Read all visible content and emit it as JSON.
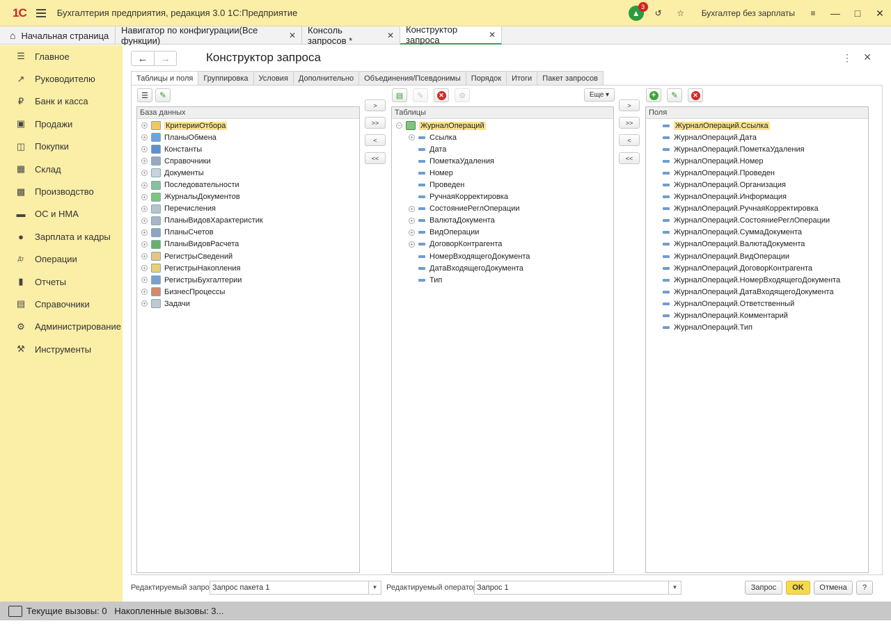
{
  "app": {
    "logo": "1С",
    "title": "Бухгалтерия предприятия, редакция 3.0 1С:Предприятие",
    "notifications": "3",
    "user": "Бухгалтер без зарплаты"
  },
  "tabs": [
    {
      "label": "Начальная страница"
    },
    {
      "label": "Навигатор по конфигурации(Все функции)"
    },
    {
      "label": "Консоль запросов *"
    },
    {
      "label": "Конструктор запроса"
    }
  ],
  "sidebar": {
    "items": [
      {
        "label": "Главное",
        "icon": "menu-icon"
      },
      {
        "label": "Руководителю",
        "icon": "trend-icon"
      },
      {
        "label": "Банк и касса",
        "icon": "ruble-icon"
      },
      {
        "label": "Продажи",
        "icon": "bag-icon"
      },
      {
        "label": "Покупки",
        "icon": "cart-icon"
      },
      {
        "label": "Склад",
        "icon": "warehouse-icon"
      },
      {
        "label": "Производство",
        "icon": "factory-icon"
      },
      {
        "label": "ОС и НМА",
        "icon": "truck-icon"
      },
      {
        "label": "Зарплата и кадры",
        "icon": "person-icon"
      },
      {
        "label": "Операции",
        "icon": "dt-kt-icon"
      },
      {
        "label": "Отчеты",
        "icon": "bar-chart-icon"
      },
      {
        "label": "Справочники",
        "icon": "book-icon"
      },
      {
        "label": "Администрирование",
        "icon": "gear-icon"
      },
      {
        "label": "Инструменты",
        "icon": "tools-icon"
      }
    ]
  },
  "form": {
    "title": "Конструктор запроса",
    "tabs": [
      "Таблицы и поля",
      "Группировка",
      "Условия",
      "Дополнительно",
      "Объединения/Псевдонимы",
      "Порядок",
      "Итоги",
      "Пакет запросов"
    ],
    "more_label": "Еще",
    "database": {
      "header": "База данных",
      "items": [
        "КритерииОтбора",
        "ПланыОбмена",
        "Константы",
        "Справочники",
        "Документы",
        "Последовательности",
        "ЖурналыДокументов",
        "Перечисления",
        "ПланыВидовХарактеристик",
        "ПланыСчетов",
        "ПланыВидовРасчета",
        "РегистрыСведений",
        "РегистрыНакопления",
        "РегистрыБухгалтерии",
        "БизнесПроцессы",
        "Задачи"
      ]
    },
    "tables": {
      "header": "Таблицы",
      "root": "ЖурналОпераций",
      "children": [
        {
          "label": "Ссылка",
          "expandable": true
        },
        {
          "label": "Дата",
          "expandable": false
        },
        {
          "label": "ПометкаУдаления",
          "expandable": false
        },
        {
          "label": "Номер",
          "expandable": false
        },
        {
          "label": "Проведен",
          "expandable": false
        },
        {
          "label": "РучнаяКорректировка",
          "expandable": false
        },
        {
          "label": "СостояниеРеглОперации",
          "expandable": true
        },
        {
          "label": "ВалютаДокумента",
          "expandable": true
        },
        {
          "label": "ВидОперации",
          "expandable": true
        },
        {
          "label": "ДоговорКонтрагента",
          "expandable": true
        },
        {
          "label": "НомерВходящегоДокумента",
          "expandable": false
        },
        {
          "label": "ДатаВходящегоДокумента",
          "expandable": false
        },
        {
          "label": "Тип",
          "expandable": false
        }
      ]
    },
    "fields": {
      "header": "Поля",
      "items": [
        "ЖурналОпераций.Ссылка",
        "ЖурналОпераций.Дата",
        "ЖурналОпераций.ПометкаУдаления",
        "ЖурналОпераций.Номер",
        "ЖурналОпераций.Проведен",
        "ЖурналОпераций.Организация",
        "ЖурналОпераций.Информация",
        "ЖурналОпераций.РучнаяКорректировка",
        "ЖурналОпераций.СостояниеРеглОперации",
        "ЖурналОпераций.СуммаДокумента",
        "ЖурналОпераций.ВалютаДокумента",
        "ЖурналОпераций.ВидОперации",
        "ЖурналОпераций.ДоговорКонтрагента",
        "ЖурналОпераций.НомерВходящегоДокумента",
        "ЖурналОпераций.ДатаВходящегоДокумента",
        "ЖурналОпераций.Ответственный",
        "ЖурналОпераций.Комментарий",
        "ЖурналОпераций.Тип"
      ]
    },
    "move_buttons": [
      ">",
      ">>",
      "<",
      "<<"
    ],
    "bottom": {
      "query_label": "Редактируемый запрос:",
      "query_value": "Запрос пакета 1",
      "operator_label": "Редактируемый оператор:",
      "operator_value": "Запрос 1",
      "btn_query": "Запрос",
      "btn_ok": "OK",
      "btn_cancel": "Отмена",
      "btn_help": "?"
    }
  },
  "status": {
    "text": "Текущие вызовы: 0   Накопленные вызовы: 3..."
  }
}
